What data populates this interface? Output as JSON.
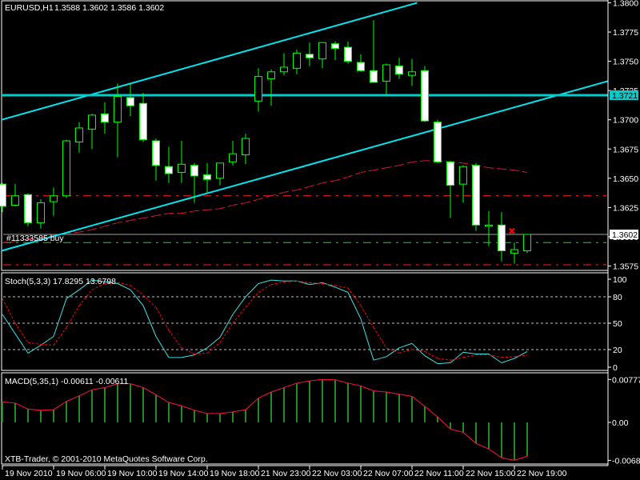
{
  "header": {
    "symbol": "EURUSD,H1",
    "ohlc": "1.3588 1.3602 1.3586 1.3602"
  },
  "order_label": "#11333585 buy",
  "copyright": "XTB-Trader, © 2001-2010 MetaQuotes Software Corp.",
  "colors": {
    "background": "#000000",
    "frame": "#ffffff",
    "candle_outline": "#00ff00",
    "bull_body": "#000000",
    "bear_body": "#ffffff",
    "trendline": "#00e5ee",
    "hline": "#00cccc",
    "ma": "#dc143c",
    "bid_line": "#a0a0a0",
    "order_line": "#32cd32",
    "stop_line": "#ff2020",
    "stoch_main": "#40e0e0",
    "stoch_signal": "#ff0000",
    "macd_hist": "#228b22",
    "macd_signal": "#ff1040"
  },
  "chart_data": [
    {
      "type": "candlestick",
      "title": "EURUSD,H1",
      "ylim": [
        1.3571,
        1.3802
      ],
      "yticks": [
        "1.3800",
        "1.3775",
        "1.3750",
        "1.3725",
        "1.3700",
        "1.3675",
        "1.3650",
        "1.3625",
        "1.3600",
        "1.3575"
      ],
      "x_labels": [
        {
          "bar": 0,
          "label": "19 Nov 2010"
        },
        {
          "bar": 4,
          "label": "19 Nov 06:00"
        },
        {
          "bar": 8,
          "label": "19 Nov 10:00"
        },
        {
          "bar": 12,
          "label": "19 Nov 14:00"
        },
        {
          "bar": 16,
          "label": "19 Nov 18:00"
        },
        {
          "bar": 20,
          "label": "21 Nov 23:00"
        },
        {
          "bar": 24,
          "label": "22 Nov 03:00"
        },
        {
          "bar": 28,
          "label": "22 Nov 07:00"
        },
        {
          "bar": 32,
          "label": "22 Nov 11:00"
        },
        {
          "bar": 36,
          "label": "22 Nov 15:00"
        },
        {
          "bar": 40,
          "label": "22 Nov 19:00"
        }
      ],
      "open": [
        1.3645,
        1.3627,
        1.3636,
        1.3612,
        1.363,
        1.3635,
        1.3681,
        1.3692,
        1.3705,
        1.3698,
        1.3719,
        1.3714,
        1.3682,
        1.366,
        1.3655,
        1.3661,
        1.3653,
        1.365,
        1.3664,
        1.367,
        1.3716,
        1.3735,
        1.3741,
        1.3744,
        1.3756,
        1.3752,
        1.3765,
        1.3762,
        1.3749,
        1.3742,
        1.3733,
        1.3746,
        1.3738,
        1.3742,
        1.3698,
        1.3664,
        1.3645,
        1.3661,
        1.3609,
        1.361,
        1.3586,
        1.3588
      ],
      "high": [
        1.3646,
        1.3645,
        1.3637,
        1.3632,
        1.3642,
        1.3683,
        1.3698,
        1.3705,
        1.3715,
        1.3731,
        1.3731,
        1.3723,
        1.3684,
        1.3677,
        1.3682,
        1.3663,
        1.3663,
        1.3663,
        1.3682,
        1.3688,
        1.3744,
        1.3743,
        1.3757,
        1.376,
        1.3766,
        1.3766,
        1.3767,
        1.3767,
        1.3756,
        1.3785,
        1.3748,
        1.3753,
        1.3752,
        1.3746,
        1.37,
        1.3665,
        1.3661,
        1.3663,
        1.3622,
        1.3621,
        1.3595,
        1.3602
      ],
      "low": [
        1.3621,
        1.3626,
        1.3609,
        1.3607,
        1.3618,
        1.3633,
        1.3672,
        1.3675,
        1.3688,
        1.3668,
        1.3703,
        1.3681,
        1.3648,
        1.3646,
        1.3646,
        1.3629,
        1.3637,
        1.3644,
        1.3661,
        1.3662,
        1.3707,
        1.3712,
        1.3738,
        1.3739,
        1.3746,
        1.3744,
        1.3751,
        1.3748,
        1.3741,
        1.3732,
        1.3722,
        1.3735,
        1.3729,
        1.3698,
        1.3663,
        1.3616,
        1.3629,
        1.3605,
        1.3592,
        1.3579,
        1.3577,
        1.3586
      ],
      "close": [
        1.3626,
        1.3635,
        1.3612,
        1.3629,
        1.3635,
        1.3682,
        1.3693,
        1.3704,
        1.3698,
        1.372,
        1.3712,
        1.3683,
        1.3661,
        1.3654,
        1.3662,
        1.3652,
        1.3649,
        1.3663,
        1.3671,
        1.3684,
        1.3737,
        1.3741,
        1.3745,
        1.3757,
        1.3753,
        1.3766,
        1.3761,
        1.375,
        1.3742,
        1.3732,
        1.3747,
        1.3739,
        1.3741,
        1.3699,
        1.3664,
        1.3644,
        1.366,
        1.361,
        1.361,
        1.3588,
        1.3589,
        1.3602
      ],
      "moving_average": [
        1.3595,
        1.3596,
        1.3598,
        1.3599,
        1.3601,
        1.3603,
        1.3604,
        1.3606,
        1.3609,
        1.3612,
        1.3614,
        1.3616,
        1.3618,
        1.362,
        1.362,
        1.3622,
        1.3623,
        1.3624,
        1.3627,
        1.3629,
        1.3632,
        1.3635,
        1.3638,
        1.364,
        1.3643,
        1.3646,
        1.3648,
        1.3651,
        1.3655,
        1.3657,
        1.3659,
        1.3661,
        1.3664,
        1.3665,
        1.3665,
        1.3664,
        1.3663,
        1.3661,
        1.3659,
        1.3658,
        1.3657,
        1.3655
      ],
      "horizontal_line": {
        "price": 1.3721,
        "label": "1.3721"
      },
      "bid_line": {
        "price": 1.3602,
        "label": "1.3602"
      },
      "order_line": {
        "price": 1.3595
      },
      "stop_lines": [
        1.3635,
        1.3576
      ],
      "trendlines": [
        {
          "from": {
            "bar": -0.19,
            "price": 1.37
          },
          "to": {
            "bar": 32.4,
            "price": 1.38
          }
        },
        {
          "from": {
            "bar": -0.19,
            "price": 1.3588
          },
          "to": {
            "bar": 47.3,
            "price": 1.3733
          }
        }
      ],
      "trade_marker": {
        "bar": 39.8,
        "price": 1.3605
      }
    },
    {
      "type": "line",
      "title": "Stoch(5,3,3) 17.8295 13.6798",
      "ylim": [
        0,
        100
      ],
      "yticks": [
        "100",
        "80",
        "50",
        "20",
        "0"
      ],
      "levels": [
        20,
        50,
        80
      ],
      "series": [
        {
          "name": "main",
          "values": [
            60,
            38,
            16,
            25,
            35,
            78,
            88,
            99,
            97,
            95,
            88,
            70,
            35,
            11,
            11,
            14,
            22,
            34,
            60,
            80,
            95,
            99,
            98,
            98,
            94,
            96,
            91,
            85,
            55,
            8,
            12,
            22,
            27,
            13,
            4,
            5,
            17,
            15,
            15,
            5,
            10,
            17.83
          ]
        },
        {
          "name": "signal",
          "values": [
            78,
            50,
            28,
            26,
            25,
            45,
            70,
            88,
            95,
            96,
            93,
            82,
            68,
            42,
            22,
            15,
            16,
            28,
            50,
            68,
            85,
            94,
            97,
            98,
            96,
            95,
            93,
            90,
            70,
            45,
            22,
            16,
            20,
            18,
            10,
            8,
            11,
            14,
            14,
            11,
            12,
            13.68
          ]
        }
      ]
    },
    {
      "type": "bar",
      "title": "MACD(5,35,1) -0.00611 -0.00611",
      "yticks": [
        "0.00777",
        "0.00",
        "-0.00686"
      ],
      "series": [
        {
          "name": "macd",
          "values": [
            0.0037,
            0.0035,
            0.0024,
            0.0022,
            0.0023,
            0.0038,
            0.0048,
            0.0059,
            0.0063,
            0.007,
            0.007,
            0.0063,
            0.005,
            0.0036,
            0.003,
            0.0022,
            0.0016,
            0.0016,
            0.0019,
            0.0023,
            0.0044,
            0.0055,
            0.0063,
            0.0071,
            0.0075,
            0.00777,
            0.0077,
            0.0071,
            0.0066,
            0.0057,
            0.0055,
            0.0051,
            0.0047,
            0.0029,
            0.001,
            -0.0012,
            -0.0018,
            -0.0038,
            -0.0048,
            -0.0064,
            -0.00686,
            -0.00611
          ]
        },
        {
          "name": "signal",
          "values": [
            0.0037,
            0.0035,
            0.0024,
            0.0022,
            0.0023,
            0.0038,
            0.0048,
            0.0059,
            0.0063,
            0.007,
            0.007,
            0.0063,
            0.005,
            0.0036,
            0.003,
            0.0022,
            0.0016,
            0.0016,
            0.0019,
            0.0023,
            0.0044,
            0.0055,
            0.0063,
            0.0071,
            0.0075,
            0.00777,
            0.0077,
            0.0071,
            0.0066,
            0.0057,
            0.0055,
            0.0051,
            0.0047,
            0.0029,
            0.001,
            -0.0012,
            -0.0018,
            -0.0038,
            -0.0048,
            -0.0064,
            -0.00686,
            -0.00611
          ]
        }
      ]
    }
  ]
}
